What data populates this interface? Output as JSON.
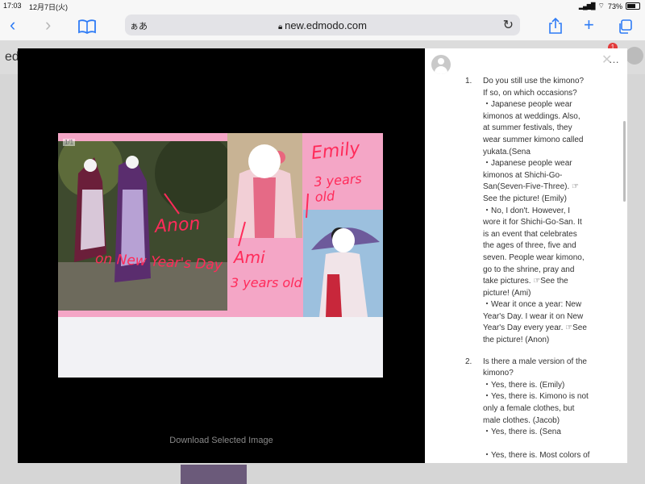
{
  "status_bar": {
    "time": "17:03",
    "date": "12月7日(火)",
    "battery_text": "73%",
    "battery_fraction": 0.73
  },
  "safari": {
    "text_size_label": "ぁあ",
    "url": "new.edmodo.com"
  },
  "background_page": {
    "logo_partial": "ed",
    "notification_count": "1"
  },
  "viewer": {
    "page_indicator": "1/1",
    "handwriting": {
      "anon": "Anon",
      "new_years_day": "on New Year's Day",
      "ami": "Ami",
      "ami_age": "3 years old",
      "emily": "Emily",
      "emily_age": "3 years old"
    },
    "download_label": "Download Selected Image"
  },
  "panel": {
    "questions": [
      {
        "number": "1.",
        "lines": [
          "Do you still use the kimono?",
          "If so, on which occasions?",
          "・Japanese people wear",
          "kimonos at weddings. Also,",
          "at summer festivals, they",
          "wear summer kimono called",
          "yukata.(Sena",
          "・Japanese people wear",
          "kimonos at Shichi-Go-",
          "San(Seven-Five-Three). ☞",
          "See the picture! (Emily)",
          "・No, I don't. However, I",
          "wore it for Shichi-Go-San. It",
          "is an event that celebrates",
          "the ages of three, five and",
          "seven. People wear kimono,",
          "go to the shrine, pray and",
          "take pictures. ☞See the",
          "picture! (Ami)",
          "・Wear it once a year: New",
          "Year's Day. I wear it on New",
          "Year's Day every year. ☞See",
          "the picture! (Anon)"
        ]
      },
      {
        "number": "2.",
        "lines": [
          "Is there a male version of the",
          "kimono?",
          "・Yes, there is. (Emily)",
          "・Yes, there is. Kimono is not",
          "only a female clothes, but",
          "male clothes. (Jacob)",
          "・Yes, there is. (Sena",
          "",
          "・Yes, there is. Most colors of"
        ]
      }
    ]
  }
}
